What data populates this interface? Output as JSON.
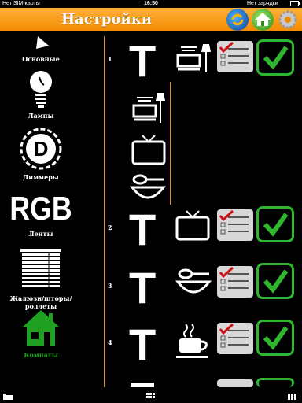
{
  "status": {
    "carrier": "Нет SIM-карты",
    "time": "16:50",
    "charging": "Нет зарядки"
  },
  "header": {
    "title": "Настройки"
  },
  "sidebar": {
    "items": [
      {
        "label": "Основные",
        "icon": "basic-icon"
      },
      {
        "label": "Лампы",
        "icon": "bulb-icon"
      },
      {
        "label": "Диммеры",
        "icon": "dimmer-icon",
        "glyph": "D"
      },
      {
        "label": "Ленты",
        "icon": "rgb-icon",
        "glyph": "RGB"
      },
      {
        "label": "Жалюзи/шторы/роллеты",
        "icon": "blinds-icon"
      },
      {
        "label": "Комнаты",
        "icon": "house-icon",
        "active_color": "#20a020"
      }
    ]
  },
  "rows": [
    {
      "number": "1",
      "type_glyph": "T",
      "device_icon": "living-room-icon"
    },
    {
      "number": "2",
      "type_glyph": "T",
      "device_icon": "tv-icon"
    },
    {
      "number": "3",
      "type_glyph": "T",
      "device_icon": "bowl-icon"
    },
    {
      "number": "4",
      "type_glyph": "T",
      "device_icon": "coffee-icon"
    }
  ],
  "colors": {
    "accent": "#f28a00",
    "check": "#2fb52f",
    "divider": "#e48a1e"
  }
}
